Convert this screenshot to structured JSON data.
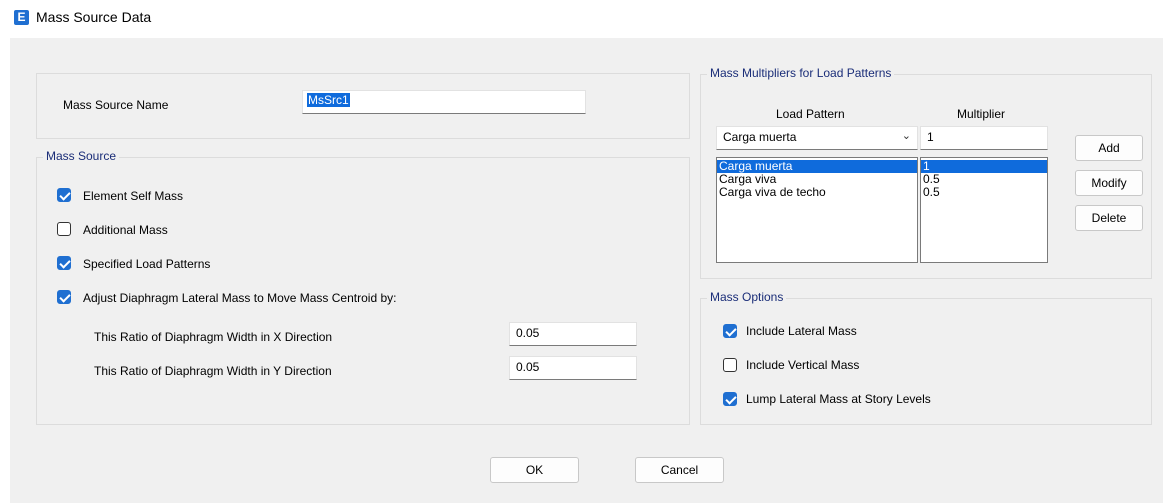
{
  "window": {
    "title": "Mass Source Data",
    "icon_letter": "E"
  },
  "name_row": {
    "label": "Mass Source Name",
    "value": "MsSrc1"
  },
  "mass_source": {
    "legend": "Mass Source",
    "element_self_mass": {
      "label": "Element Self Mass",
      "checked": true
    },
    "additional_mass": {
      "label": "Additional Mass",
      "checked": false
    },
    "specified_load_patterns": {
      "label": "Specified Load Patterns",
      "checked": true
    },
    "adjust_diaphragm": {
      "label": "Adjust Diaphragm Lateral Mass to Move Mass Centroid by:",
      "checked": true
    },
    "ratio_x": {
      "label": "This Ratio of Diaphragm Width in X Direction",
      "value": "0.05"
    },
    "ratio_y": {
      "label": "This Ratio of Diaphragm Width in Y Direction",
      "value": "0.05"
    }
  },
  "multipliers": {
    "legend": "Mass Multipliers for Load Patterns",
    "col_load_pattern": "Load Pattern",
    "col_multiplier": "Multiplier",
    "selected_pattern": "Carga muerta",
    "multiplier_value": "1",
    "rows": [
      {
        "pattern": "Carga muerta",
        "multiplier": "1",
        "selected": true
      },
      {
        "pattern": "Carga viva",
        "multiplier": "0.5",
        "selected": false
      },
      {
        "pattern": "Carga viva de techo",
        "multiplier": "0.5",
        "selected": false
      }
    ],
    "add_label": "Add",
    "modify_label": "Modify",
    "delete_label": "Delete"
  },
  "mass_options": {
    "legend": "Mass Options",
    "include_lateral": {
      "label": "Include Lateral Mass",
      "checked": true
    },
    "include_vertical": {
      "label": "Include Vertical Mass",
      "checked": false
    },
    "lump_lateral": {
      "label": "Lump Lateral Mass at Story Levels",
      "checked": true
    }
  },
  "footer": {
    "ok_label": "OK",
    "cancel_label": "Cancel"
  },
  "colors": {
    "accent": "#1f6fd1",
    "legend_text": "#1a2d78",
    "selection": "#0f6bdc",
    "dialog_bg": "#f0f0f0"
  }
}
